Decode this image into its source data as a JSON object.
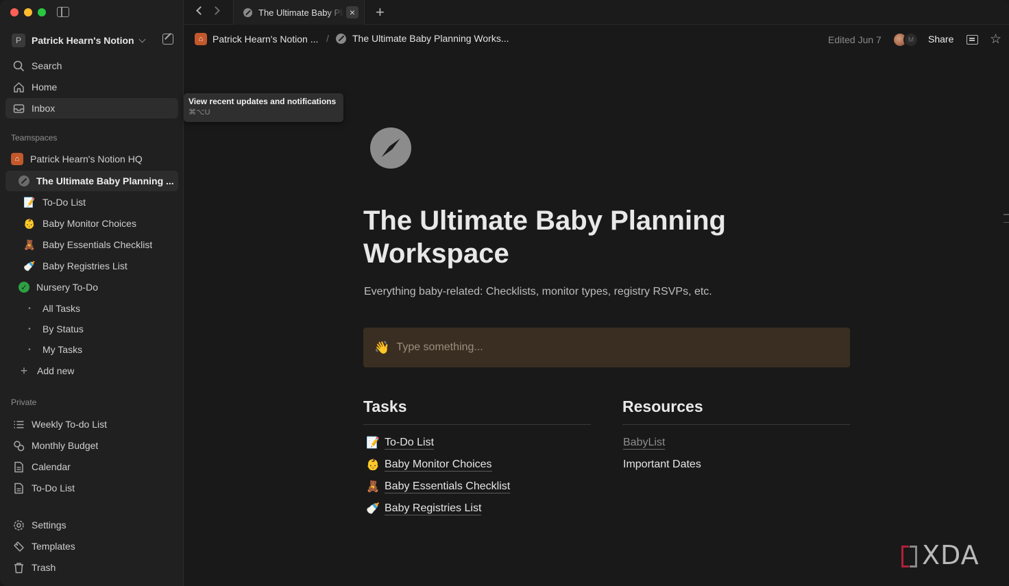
{
  "sidebar": {
    "workspace": {
      "initial": "P",
      "name": "Patrick Hearn's Notion"
    },
    "nav": [
      {
        "label": "Search",
        "icon": "search-icon"
      },
      {
        "label": "Home",
        "icon": "home-icon"
      },
      {
        "label": "Inbox",
        "icon": "inbox-icon"
      }
    ],
    "teamspaces_label": "Teamspaces",
    "teamspace": {
      "label": "Patrick Hearn's Notion HQ",
      "icon": "house-icon"
    },
    "active_page": {
      "label": "The Ultimate Baby Planning ..."
    },
    "children": [
      {
        "label": "To-Do List",
        "icon": "📝"
      },
      {
        "label": "Baby Monitor Choices",
        "icon": "👶"
      },
      {
        "label": "Baby Essentials Checklist",
        "icon": "🧸"
      },
      {
        "label": "Baby Registries List",
        "icon": "🍼"
      }
    ],
    "nursery": {
      "label": "Nursery To-Do"
    },
    "nursery_views": [
      {
        "label": "All Tasks"
      },
      {
        "label": "By Status"
      },
      {
        "label": "My Tasks"
      }
    ],
    "add_new": "Add new",
    "private_label": "Private",
    "private": [
      {
        "label": "Weekly To-do List",
        "icon": "list-icon"
      },
      {
        "label": "Monthly Budget",
        "icon": "budget-icon"
      },
      {
        "label": "Calendar",
        "icon": "document-icon"
      },
      {
        "label": "To-Do List",
        "icon": "document-icon"
      }
    ],
    "footer": [
      {
        "label": "Settings",
        "icon": "gear-icon"
      },
      {
        "label": "Templates",
        "icon": "templates-icon"
      },
      {
        "label": "Trash",
        "icon": "trash-icon"
      }
    ]
  },
  "tabbar": {
    "tab_title": "The Ultimate Baby Planning Workspace",
    "close": "×",
    "add": "+"
  },
  "header": {
    "crumb_workspace": "Patrick Hearn's Notion ...",
    "crumb_sep": "/",
    "crumb_page": "The Ultimate Baby Planning Works...",
    "edited": "Edited Jun 7",
    "avatar2_initial": "M",
    "share": "Share"
  },
  "tooltip": {
    "title": "View recent updates and notifications",
    "shortcut": "⌘⌥U"
  },
  "page": {
    "title": "The Ultimate Baby Planning Workspace",
    "description": "Everything baby-related: Checklists, monitor types, registry RSVPs, etc.",
    "callout_emoji": "👋",
    "callout_placeholder": "Type something..."
  },
  "tasks": {
    "heading": "Tasks",
    "links": [
      {
        "label": "To-Do List",
        "icon": "📝"
      },
      {
        "label": "Baby Monitor Choices",
        "icon": "👶"
      },
      {
        "label": "Baby Essentials Checklist",
        "icon": "🧸"
      },
      {
        "label": "Baby Registries List",
        "icon": "🍼"
      }
    ]
  },
  "resources": {
    "heading": "Resources",
    "link": "BabyList",
    "item": "Important Dates"
  },
  "watermark": "XDA",
  "colors": {
    "callout_bg": "#3a2e22",
    "teamspace_badge": "#c2582c",
    "nursery_check": "#2ea043"
  }
}
